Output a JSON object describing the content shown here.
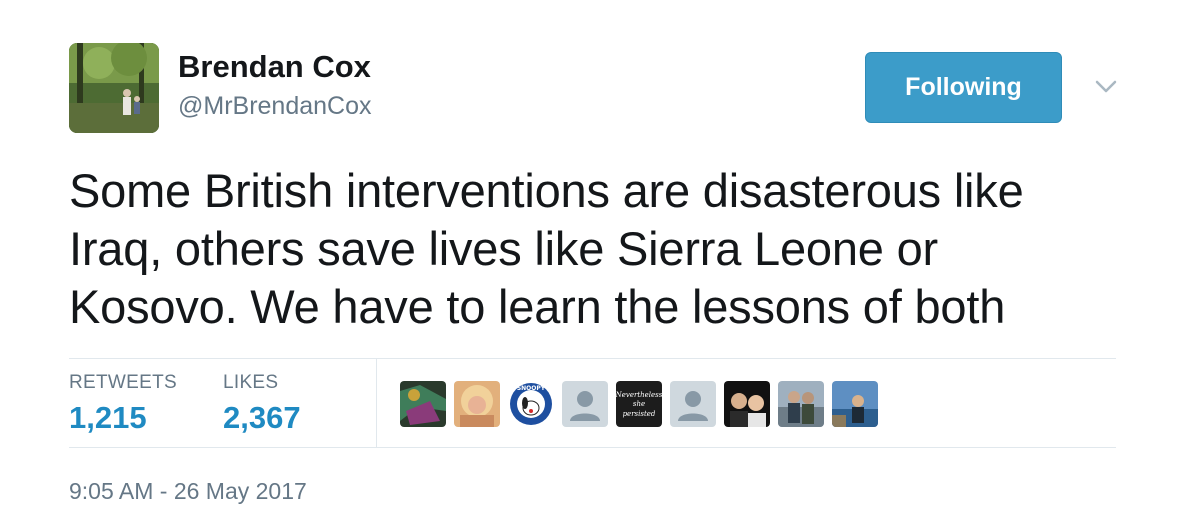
{
  "author": {
    "name": "Brendan Cox",
    "handle": "@MrBrendanCox",
    "avatar_icon": "profile-photo-forest"
  },
  "follow_button": {
    "label": "Following",
    "color": "#3c9cc9"
  },
  "menu": {
    "icon": "chevron-down-icon"
  },
  "tweet": {
    "lines": [
      "Some British interventions are disasterous like",
      "Iraq, others save lives like Sierra Leone or",
      "Kosovo. We have to learn the lessons of both"
    ]
  },
  "stats": {
    "retweets_label": "RETWEETS",
    "retweets_value": "1,215",
    "likes_label": "LIKES",
    "likes_value": "2,367"
  },
  "likers": {
    "persisted_badge_lines": [
      "Nevertheless",
      "she",
      "persisted"
    ],
    "snoopy_badge_text": "SNOOPY"
  },
  "timestamp": "9:05 AM - 26 May 2017",
  "colors": {
    "accent": "#1f8ac2",
    "muted": "#657786",
    "text": "#14171a",
    "divider": "#e1e8ed"
  }
}
